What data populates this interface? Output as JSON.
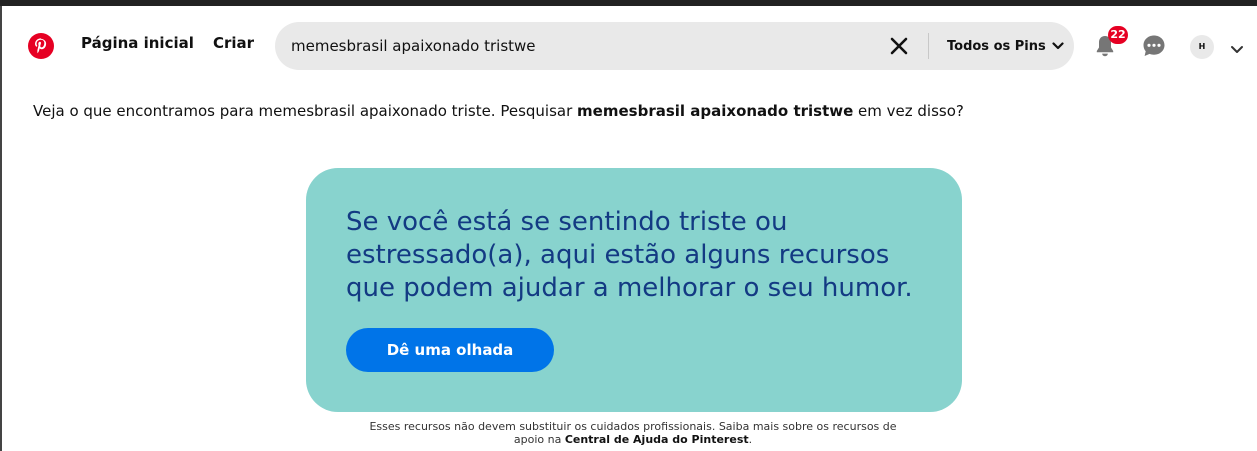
{
  "colors": {
    "brand_red": "#e60023",
    "card_bg": "#88d3ce",
    "card_text": "#133a83",
    "cta_bg": "#0074e8",
    "search_bg": "#e9e9e9"
  },
  "header": {
    "logo_icon": "pinterest-logo",
    "nav": {
      "home_label": "Página inicial",
      "create_label": "Criar"
    },
    "search": {
      "value": "memesbrasil apaixonado tristwe",
      "clear_icon": "close-x",
      "filter_label": "Todos os Pins",
      "filter_icon": "chevron-down"
    },
    "notifications": {
      "icon": "bell",
      "count": "22"
    },
    "messages_icon": "chat-bubble-dots",
    "avatar_initial": "H",
    "account_menu_icon": "chevron-down"
  },
  "suggestion": {
    "prefix": "Veja o que encontramos para memesbrasil apaixonado triste. Pesquisar ",
    "original_query": "memesbrasil apaixonado tristwe",
    "suffix": " em vez disso?"
  },
  "wellbeing_card": {
    "message": "Se você está se sentindo triste ou estressado(a), aqui estão alguns recursos que podem ajudar a melhorar o seu humor.",
    "button_label": "Dê uma olhada"
  },
  "disclaimer": {
    "text": "Esses recursos não devem substituir os cuidados profissionais. Saiba mais sobre os recursos de apoio na ",
    "link_label": "Central de Ajuda do Pinterest",
    "end": "."
  }
}
